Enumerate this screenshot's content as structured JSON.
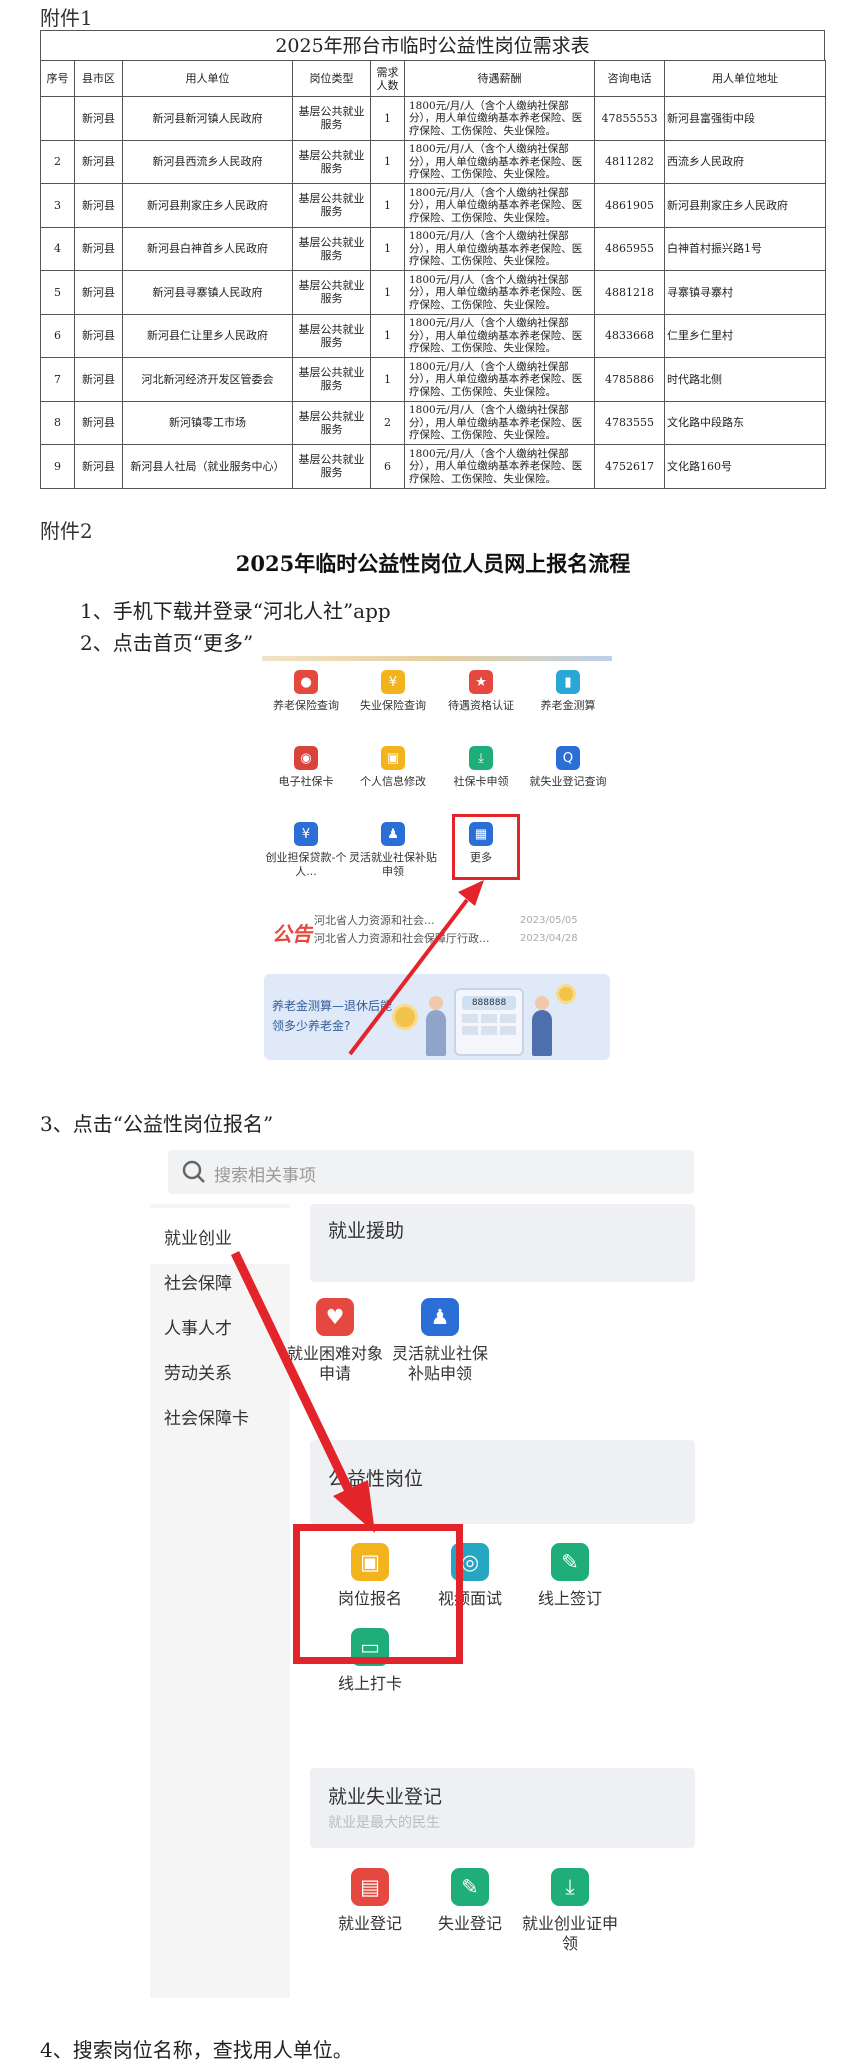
{
  "attachment1": {
    "label": "附件1"
  },
  "table": {
    "title": "2025年邢台市临时公益性岗位需求表",
    "headers": [
      "序号",
      "县市区",
      "用人单位",
      "岗位类型",
      "需求人数",
      "待遇薪酬",
      "咨询电话",
      "用人单位地址"
    ],
    "rows": [
      [
        "",
        "新河县",
        "新河县新河镇人民政府",
        "基层公共就业服务",
        "1",
        "1800元/月/人（含个人缴纳社保部分），用人单位缴纳基本养老保险、医疗保险、工伤保险、失业保险。",
        "47855553",
        "新河县富强街中段"
      ],
      [
        "2",
        "新河县",
        "新河县西流乡人民政府",
        "基层公共就业服务",
        "1",
        "1800元/月/人（含个人缴纳社保部分），用人单位缴纳基本养老保险、医疗保险、工伤保险、失业保险。",
        "4811282",
        "西流乡人民政府"
      ],
      [
        "3",
        "新河县",
        "新河县荆家庄乡人民政府",
        "基层公共就业服务",
        "1",
        "1800元/月/人（含个人缴纳社保部分），用人单位缴纳基本养老保险、医疗保险、工伤保险、失业保险。",
        "4861905",
        "新河县荆家庄乡人民政府"
      ],
      [
        "4",
        "新河县",
        "新河县白神首乡人民政府",
        "基层公共就业服务",
        "1",
        "1800元/月/人（含个人缴纳社保部分），用人单位缴纳基本养老保险、医疗保险、工伤保险、失业保险。",
        "4865955",
        "白神首村振兴路1号"
      ],
      [
        "5",
        "新河县",
        "新河县寻寨镇人民政府",
        "基层公共就业服务",
        "1",
        "1800元/月/人（含个人缴纳社保部分），用人单位缴纳基本养老保险、医疗保险、工伤保险、失业保险。",
        "4881218",
        "寻寨镇寻寨村"
      ],
      [
        "6",
        "新河县",
        "新河县仁让里乡人民政府",
        "基层公共就业服务",
        "1",
        "1800元/月/人（含个人缴纳社保部分），用人单位缴纳基本养老保险、医疗保险、工伤保险、失业保险。",
        "4833668",
        "仁里乡仁里村"
      ],
      [
        "7",
        "新河县",
        "河北新河经济开发区管委会",
        "基层公共就业服务",
        "1",
        "1800元/月/人（含个人缴纳社保部分），用人单位缴纳基本养老保险、医疗保险、工伤保险、失业保险。",
        "4785886",
        "时代路北侧"
      ],
      [
        "8",
        "新河县",
        "新河镇零工市场",
        "基层公共就业服务",
        "2",
        "1800元/月/人（含个人缴纳社保部分），用人单位缴纳基本养老保险、医疗保险、工伤保险、失业保险。",
        "4783555",
        "文化路中段路东"
      ],
      [
        "9",
        "新河县",
        "新河县人社局（就业服务中心）",
        "基层公共就业服务",
        "6",
        "1800元/月/人（含个人缴纳社保部分），用人单位缴纳基本养老保险、医疗保险、工伤保险、失业保险。",
        "4752617",
        "文化路160号"
      ]
    ]
  },
  "attachment2": {
    "label": "附件2"
  },
  "doc_title": "2025年临时公益性岗位人员网上报名流程",
  "steps": {
    "s1": "1、手机下载并登录“河北人社”app",
    "s2": "2、点击首页“更多”",
    "s3": "3、点击“公益性岗位报名”",
    "s4": "4、搜索岗位名称，查找用人单位。"
  },
  "shot1": {
    "grid": [
      {
        "label": "养老保险查询",
        "icon": "shield-user-icon",
        "color": "#e5483f"
      },
      {
        "label": "失业保险查询",
        "icon": "coin-icon",
        "color": "#f3b31c"
      },
      {
        "label": "待遇资格认证",
        "icon": "star-badge-icon",
        "color": "#e5483f"
      },
      {
        "label": "养老金测算",
        "icon": "bar-chart-icon",
        "color": "#2aa7d6"
      },
      {
        "label": "电子社保卡",
        "icon": "social-card-icon",
        "color": "#d9443a"
      },
      {
        "label": "个人信息修改",
        "icon": "person-card-icon",
        "color": "#f3b31c"
      },
      {
        "label": "社保卡申领",
        "icon": "download-box-icon",
        "color": "#1fae7a"
      },
      {
        "label": "就失业登记查询",
        "icon": "search-icon",
        "color": "#2b6fd6"
      },
      {
        "label": "创业担保贷款-个人...",
        "icon": "yuan-shield-icon",
        "color": "#2b6fd6"
      },
      {
        "label": "灵活就业社保补贴申领",
        "icon": "flex-job-icon",
        "color": "#2b6fd6"
      },
      {
        "label": "更多",
        "icon": "grid-more-icon",
        "color": "#2b6fd6"
      }
    ],
    "notice_badge": "公告",
    "notices": [
      {
        "text": "河北省人力资源和社会...",
        "date": "2023/05/05"
      },
      {
        "text": "河北省人力资源和社会保障厅行政...",
        "date": "2023/04/28"
      }
    ],
    "banner_line1": "养老金测算—退休后能",
    "banner_line2": "领多少养老金?",
    "calc_display": "888888"
  },
  "shot2": {
    "search_placeholder": "搜索相关事项",
    "sidebar": [
      "就业创业",
      "社会保障",
      "人事人才",
      "劳动关系",
      "社会保障卡"
    ],
    "section1_title": "就业援助",
    "section1_items": [
      {
        "label": "就业困难对象申请",
        "icon": "heart-hand-icon",
        "color": "#e5483f"
      },
      {
        "label": "灵活就业社保补贴申领",
        "icon": "flex-job-icon",
        "color": "#2b6fd6"
      }
    ],
    "section2_title": "公益性岗位",
    "section2_items": [
      {
        "label": "岗位报名",
        "icon": "person-card-icon",
        "color": "#f3b31c"
      },
      {
        "label": "视频面试",
        "icon": "camera-icon",
        "color": "#27a6c4"
      },
      {
        "label": "线上签订",
        "icon": "pen-sign-icon",
        "color": "#1fae7a"
      },
      {
        "label": "线上打卡",
        "icon": "clock-in-icon",
        "color": "#1fae7a"
      }
    ],
    "section3_title": "就业失业登记",
    "section3_subtitle": "就业是最大的民生",
    "section3_items": [
      {
        "label": "就业登记",
        "icon": "briefcase-icon",
        "color": "#e5483f"
      },
      {
        "label": "失业登记",
        "icon": "pen-sign-icon",
        "color": "#1fae7a"
      },
      {
        "label": "就业创业证申领",
        "icon": "download-box-icon",
        "color": "#1fae7a"
      }
    ]
  },
  "colors": {
    "highlight": "#e3242b",
    "arrow": "#e3242b"
  }
}
